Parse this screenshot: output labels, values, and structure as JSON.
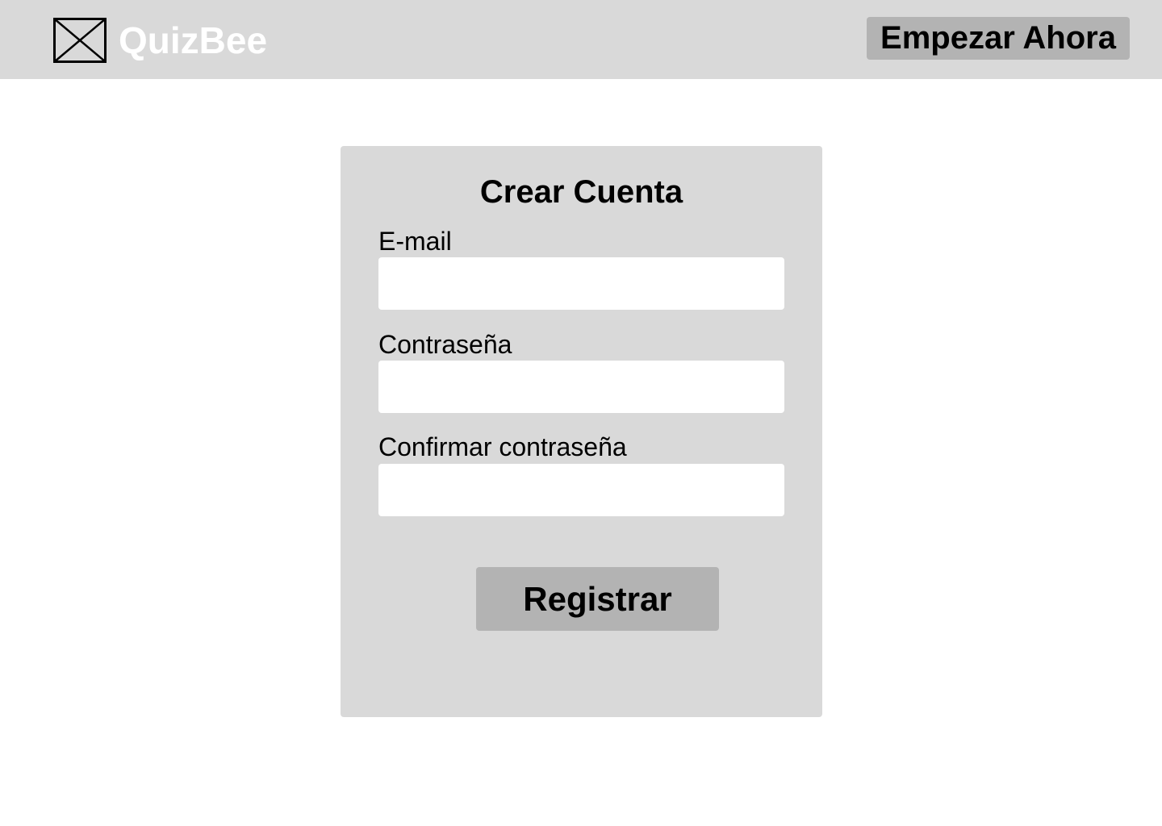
{
  "header": {
    "brand_name": "QuizBee",
    "logo_icon": "image-placeholder-icon",
    "cta_label": "Empezar Ahora"
  },
  "signup_form": {
    "title": "Crear Cuenta",
    "fields": [
      {
        "label": "E-mail",
        "value": "",
        "placeholder": ""
      },
      {
        "label": "Contraseña",
        "value": "",
        "placeholder": ""
      },
      {
        "label": "Confirmar contraseña",
        "value": "",
        "placeholder": ""
      }
    ],
    "submit_label": "Registrar"
  },
  "colors": {
    "header_background": "#d9d9d9",
    "card_background": "#d9d9d9",
    "button_background": "#b3b3b3",
    "brand_text": "#ffffff",
    "input_background": "#ffffff"
  }
}
